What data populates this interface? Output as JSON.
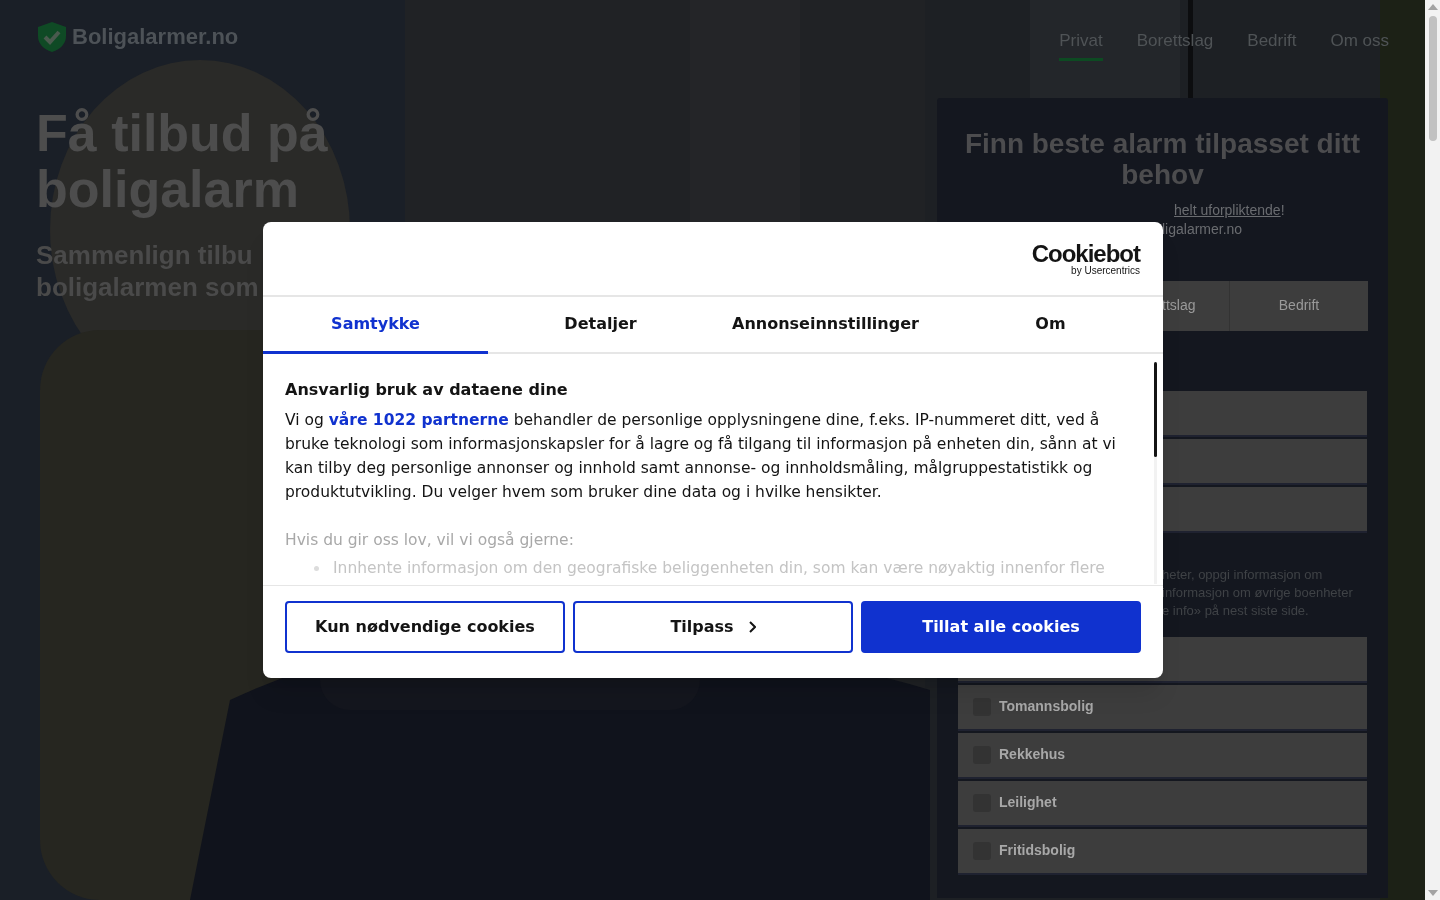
{
  "header": {
    "logo": "Boligalarmer.no",
    "nav": [
      {
        "label": "Privat",
        "selected": true
      },
      {
        "label": "Borettslag",
        "selected": false
      },
      {
        "label": "Bedrift",
        "selected": false
      },
      {
        "label": "Om oss",
        "selected": false
      }
    ]
  },
  "hero": {
    "title_lines": [
      "Få tilbud på",
      "boligalarm"
    ],
    "subtitle_lines": [
      "Sammenlign tilbu",
      "boligalarmen som"
    ]
  },
  "panel": {
    "title": "Finn beste alarm tilpasset ditt behov",
    "intro": {
      "link": "helt uforpliktende",
      "after": "!"
    },
    "intro_line2": "ligalarmer.no",
    "tabs": [
      {
        "label": "ttslag",
        "selected": false
      },
      {
        "label": "Bedrift",
        "selected": false
      }
    ],
    "field_count_rows": [
      "",
      "",
      ""
    ],
    "info_lines": [
      "heter, oppgi informasjon om",
      "informasjon om øvrige boenheter",
      "e info» på nest siste side."
    ],
    "options": [
      {
        "label": "Tomannsbolig",
        "checked": false
      },
      {
        "label": "Rekkehus",
        "checked": false
      },
      {
        "label": "Leilighet",
        "checked": false
      },
      {
        "label": "Fritidsbolig",
        "checked": false
      }
    ]
  },
  "cookie_dialog": {
    "logo": "Cookiebot",
    "logo_sub": "by Usercentrics",
    "tabs": [
      {
        "label": "Samtykke",
        "selected": true
      },
      {
        "label": "Detaljer",
        "selected": false
      },
      {
        "label": "Annonseinnstillinger",
        "selected": false
      },
      {
        "label": "Om",
        "selected": false
      }
    ],
    "heading": "Ansvarlig bruk av dataene dine",
    "body": {
      "before": "Vi og",
      "link": "våre 1022 partnerne",
      "after": "behandler de personlige opplysningene dine, f.eks. IP-nummeret ditt, ved å bruke teknologi som informasjonskapsler for å lagre og få tilgang til informasjon på enheten din, sånn at vi kan tilby deg personlige annonser og innhold samt annonse- og innholdsmåling, målgruppestatistikk og produktutvikling. Du velger hvem som bruker dine data og i hvilke hensikter."
    },
    "purposes_intro": "Hvis du gir oss lov, vil vi også gjerne:",
    "purposes": [
      "Innhente informasjon om den geografiske beliggenheten din, som kan være nøyaktig innenfor flere"
    ],
    "buttons": [
      {
        "label": "Kun nødvendige cookies",
        "kind": "outline"
      },
      {
        "label": "Tilpass",
        "kind": "chevron"
      },
      {
        "label": "Tillat alle cookies",
        "kind": "primary"
      }
    ]
  }
}
